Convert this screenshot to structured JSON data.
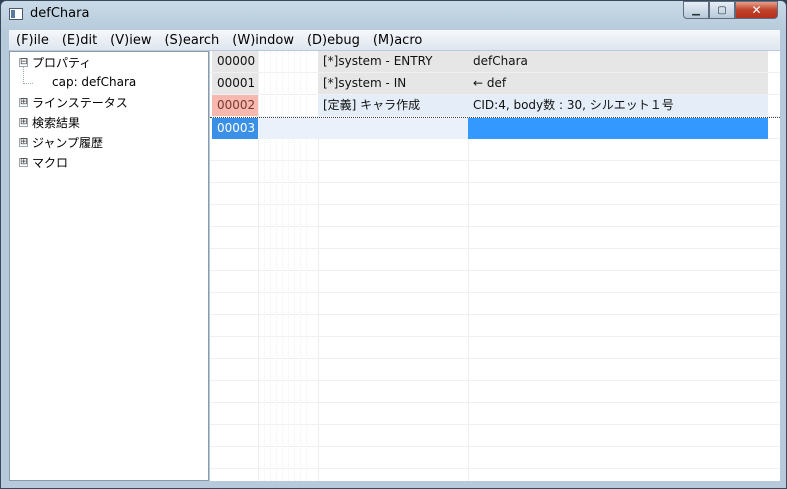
{
  "window": {
    "title": "defChara"
  },
  "menu": [
    "(F)ile",
    "(E)dit",
    "(V)iew",
    "(S)earch",
    "(W)indow",
    "(D)ebug",
    "(M)acro"
  ],
  "tree": [
    {
      "label": "プロパティ",
      "expander": "⊟",
      "level": 0
    },
    {
      "label": "cap: defChara",
      "expander": "",
      "level": 1
    },
    {
      "label": "ラインステータス",
      "expander": "⊞",
      "level": 0
    },
    {
      "label": "検索結果",
      "expander": "⊞",
      "level": 0
    },
    {
      "label": "ジャンプ履歴",
      "expander": "⊞",
      "level": 0
    },
    {
      "label": "マクロ",
      "expander": "⊞",
      "level": 0
    }
  ],
  "rows": [
    {
      "no": "00000",
      "a": "[*]system -  ENTRY",
      "b": "defChara"
    },
    {
      "no": "00001",
      "a": "[*]system -  IN",
      "b": "← def"
    },
    {
      "no": "00002",
      "a": "[定義] キャラ作成",
      "b": "CID:4, body数 : 30, シルエット１号"
    },
    {
      "no": "00003",
      "a": "",
      "b": ""
    }
  ]
}
